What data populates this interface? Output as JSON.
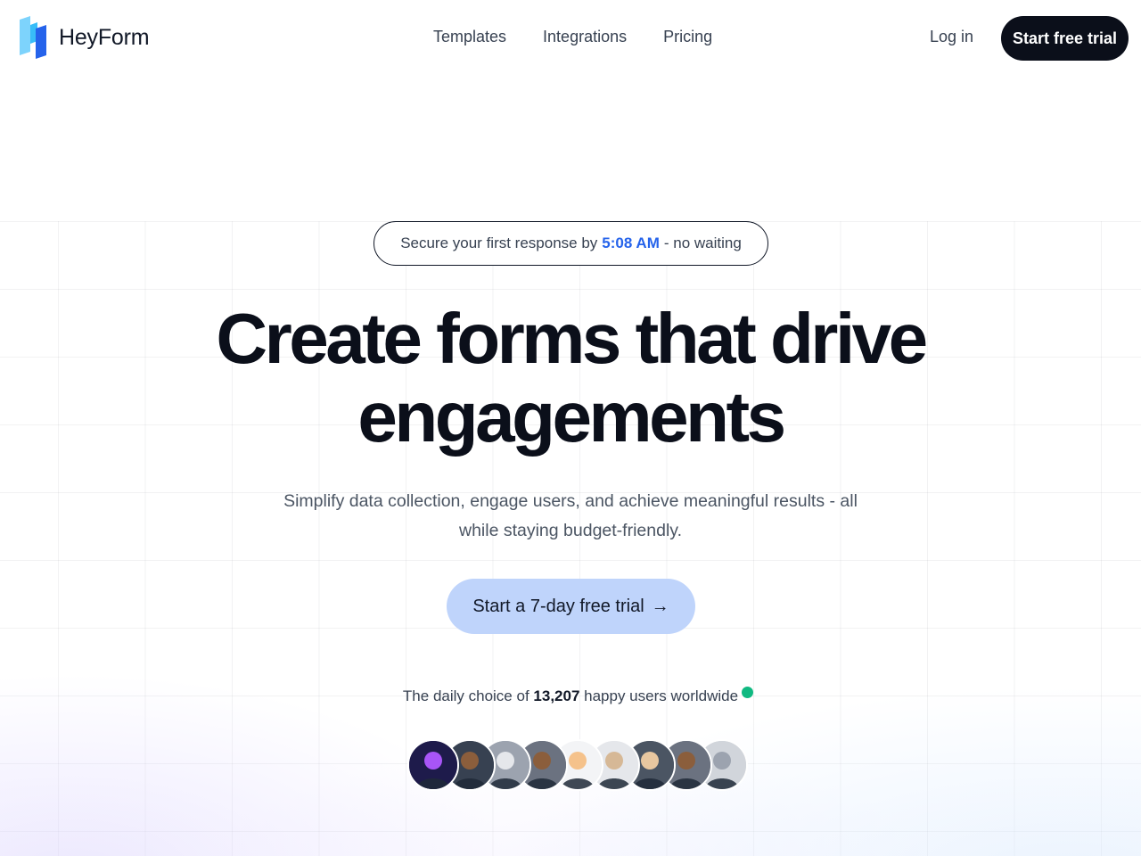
{
  "header": {
    "brand": "HeyForm",
    "nav": [
      {
        "label": "Templates"
      },
      {
        "label": "Integrations"
      },
      {
        "label": "Pricing"
      }
    ],
    "login_label": "Log in",
    "cta_label": "Start free trial"
  },
  "hero": {
    "pill": {
      "prefix": "Secure your first response by",
      "time": "5:08 AM",
      "suffix": "- no waiting"
    },
    "headline_line1": "Create forms that drive",
    "headline_line2": "engagements",
    "subtext": "Simplify data collection, engage users, and achieve meaningful results - all while staying budget-friendly.",
    "cta_label": "Start a 7-day free trial",
    "cta_arrow": "→",
    "social_prefix": "The daily choice of",
    "social_count": "13,207",
    "social_suffix": "happy users worldwide"
  },
  "avatars": [
    {
      "icon": "user-avatar",
      "bg": "#1e1b4b",
      "fg": "#a855f7"
    },
    {
      "icon": "user-avatar",
      "bg": "#374151",
      "fg": "#8b5e3c"
    },
    {
      "icon": "user-avatar",
      "bg": "#9ca3af",
      "fg": "#e5e7eb"
    },
    {
      "icon": "user-avatar",
      "bg": "#6b7280",
      "fg": "#8b5e3c"
    },
    {
      "icon": "user-avatar",
      "bg": "#f3f4f6",
      "fg": "#f5c28b"
    },
    {
      "icon": "user-avatar",
      "bg": "#e5e7eb",
      "fg": "#d6b896"
    },
    {
      "icon": "user-avatar",
      "bg": "#4b5563",
      "fg": "#e8c7a0"
    },
    {
      "icon": "user-avatar",
      "bg": "#6b7280",
      "fg": "#8b5e3c"
    },
    {
      "icon": "user-avatar",
      "bg": "#d1d5db",
      "fg": "#9ca3af"
    }
  ],
  "colors": {
    "accent": "#2563eb",
    "cta_dark": "#0b0f1a",
    "cta_light": "#bfd4fb",
    "online": "#10b981"
  }
}
